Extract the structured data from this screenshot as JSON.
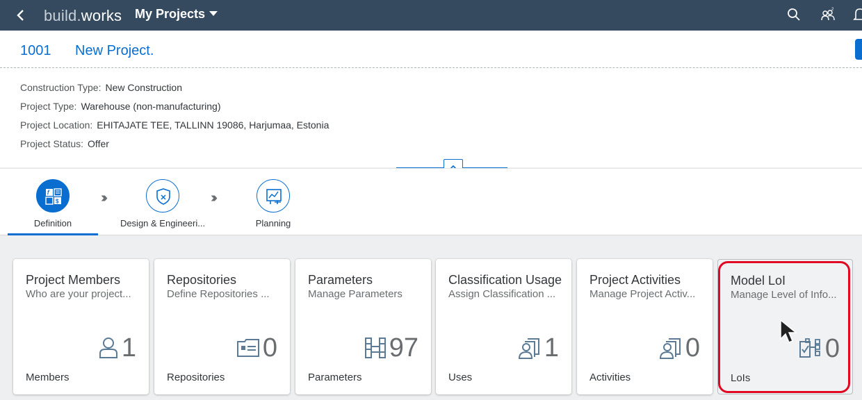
{
  "shell": {
    "brand_part1": "build.",
    "brand_part2": "works",
    "app_title": "My Projects",
    "icons": [
      "back-icon",
      "search-icon",
      "users-icon",
      "notification-icon"
    ]
  },
  "header": {
    "project_id": "1001",
    "project_name": "New Project."
  },
  "attributes": [
    {
      "label": "Construction Type:",
      "value": "New Construction"
    },
    {
      "label": "Project Type:",
      "value": "Warehouse (non-manufacturing)"
    },
    {
      "label": "Project Location:",
      "value": "EHITAJATE TEE, TALLINN 19086, Harjumaa, Estonia"
    },
    {
      "label": "Project Status:",
      "value": "Offer"
    }
  ],
  "nav": {
    "steps": [
      {
        "label": "Definition",
        "icon": "definition-icon",
        "active": true
      },
      {
        "label": "Design & Engineeri...",
        "icon": "shield-icon",
        "active": false
      },
      {
        "label": "Planning",
        "icon": "planning-chart-icon",
        "active": false
      }
    ]
  },
  "tiles": [
    {
      "title": "Project Members",
      "subtitle": "Who are your project...",
      "value": "1",
      "footer": "Members",
      "icon": "person-icon"
    },
    {
      "title": "Repositories",
      "subtitle": "Define Repositories ...",
      "value": "0",
      "footer": "Repositories",
      "icon": "id-card-icon"
    },
    {
      "title": "Parameters",
      "subtitle": "Manage Parameters",
      "value": "97",
      "footer": "Parameters",
      "icon": "parameters-icon"
    },
    {
      "title": "Classification Usage",
      "subtitle": "Assign Classification ...",
      "value": "1",
      "footer": "Uses",
      "icon": "people-group-icon"
    },
    {
      "title": "Project Activities",
      "subtitle": "Manage Project Activ...",
      "value": "0",
      "footer": "Activities",
      "icon": "people-group-icon"
    },
    {
      "title": "Model LoI",
      "subtitle": "Manage Level of Info...",
      "value": "0",
      "footer": "LoIs",
      "icon": "hierarchy-check-icon"
    }
  ],
  "colors": {
    "shell": "#354a5f",
    "accent": "#0a6ed1",
    "highlight": "#e00822"
  }
}
